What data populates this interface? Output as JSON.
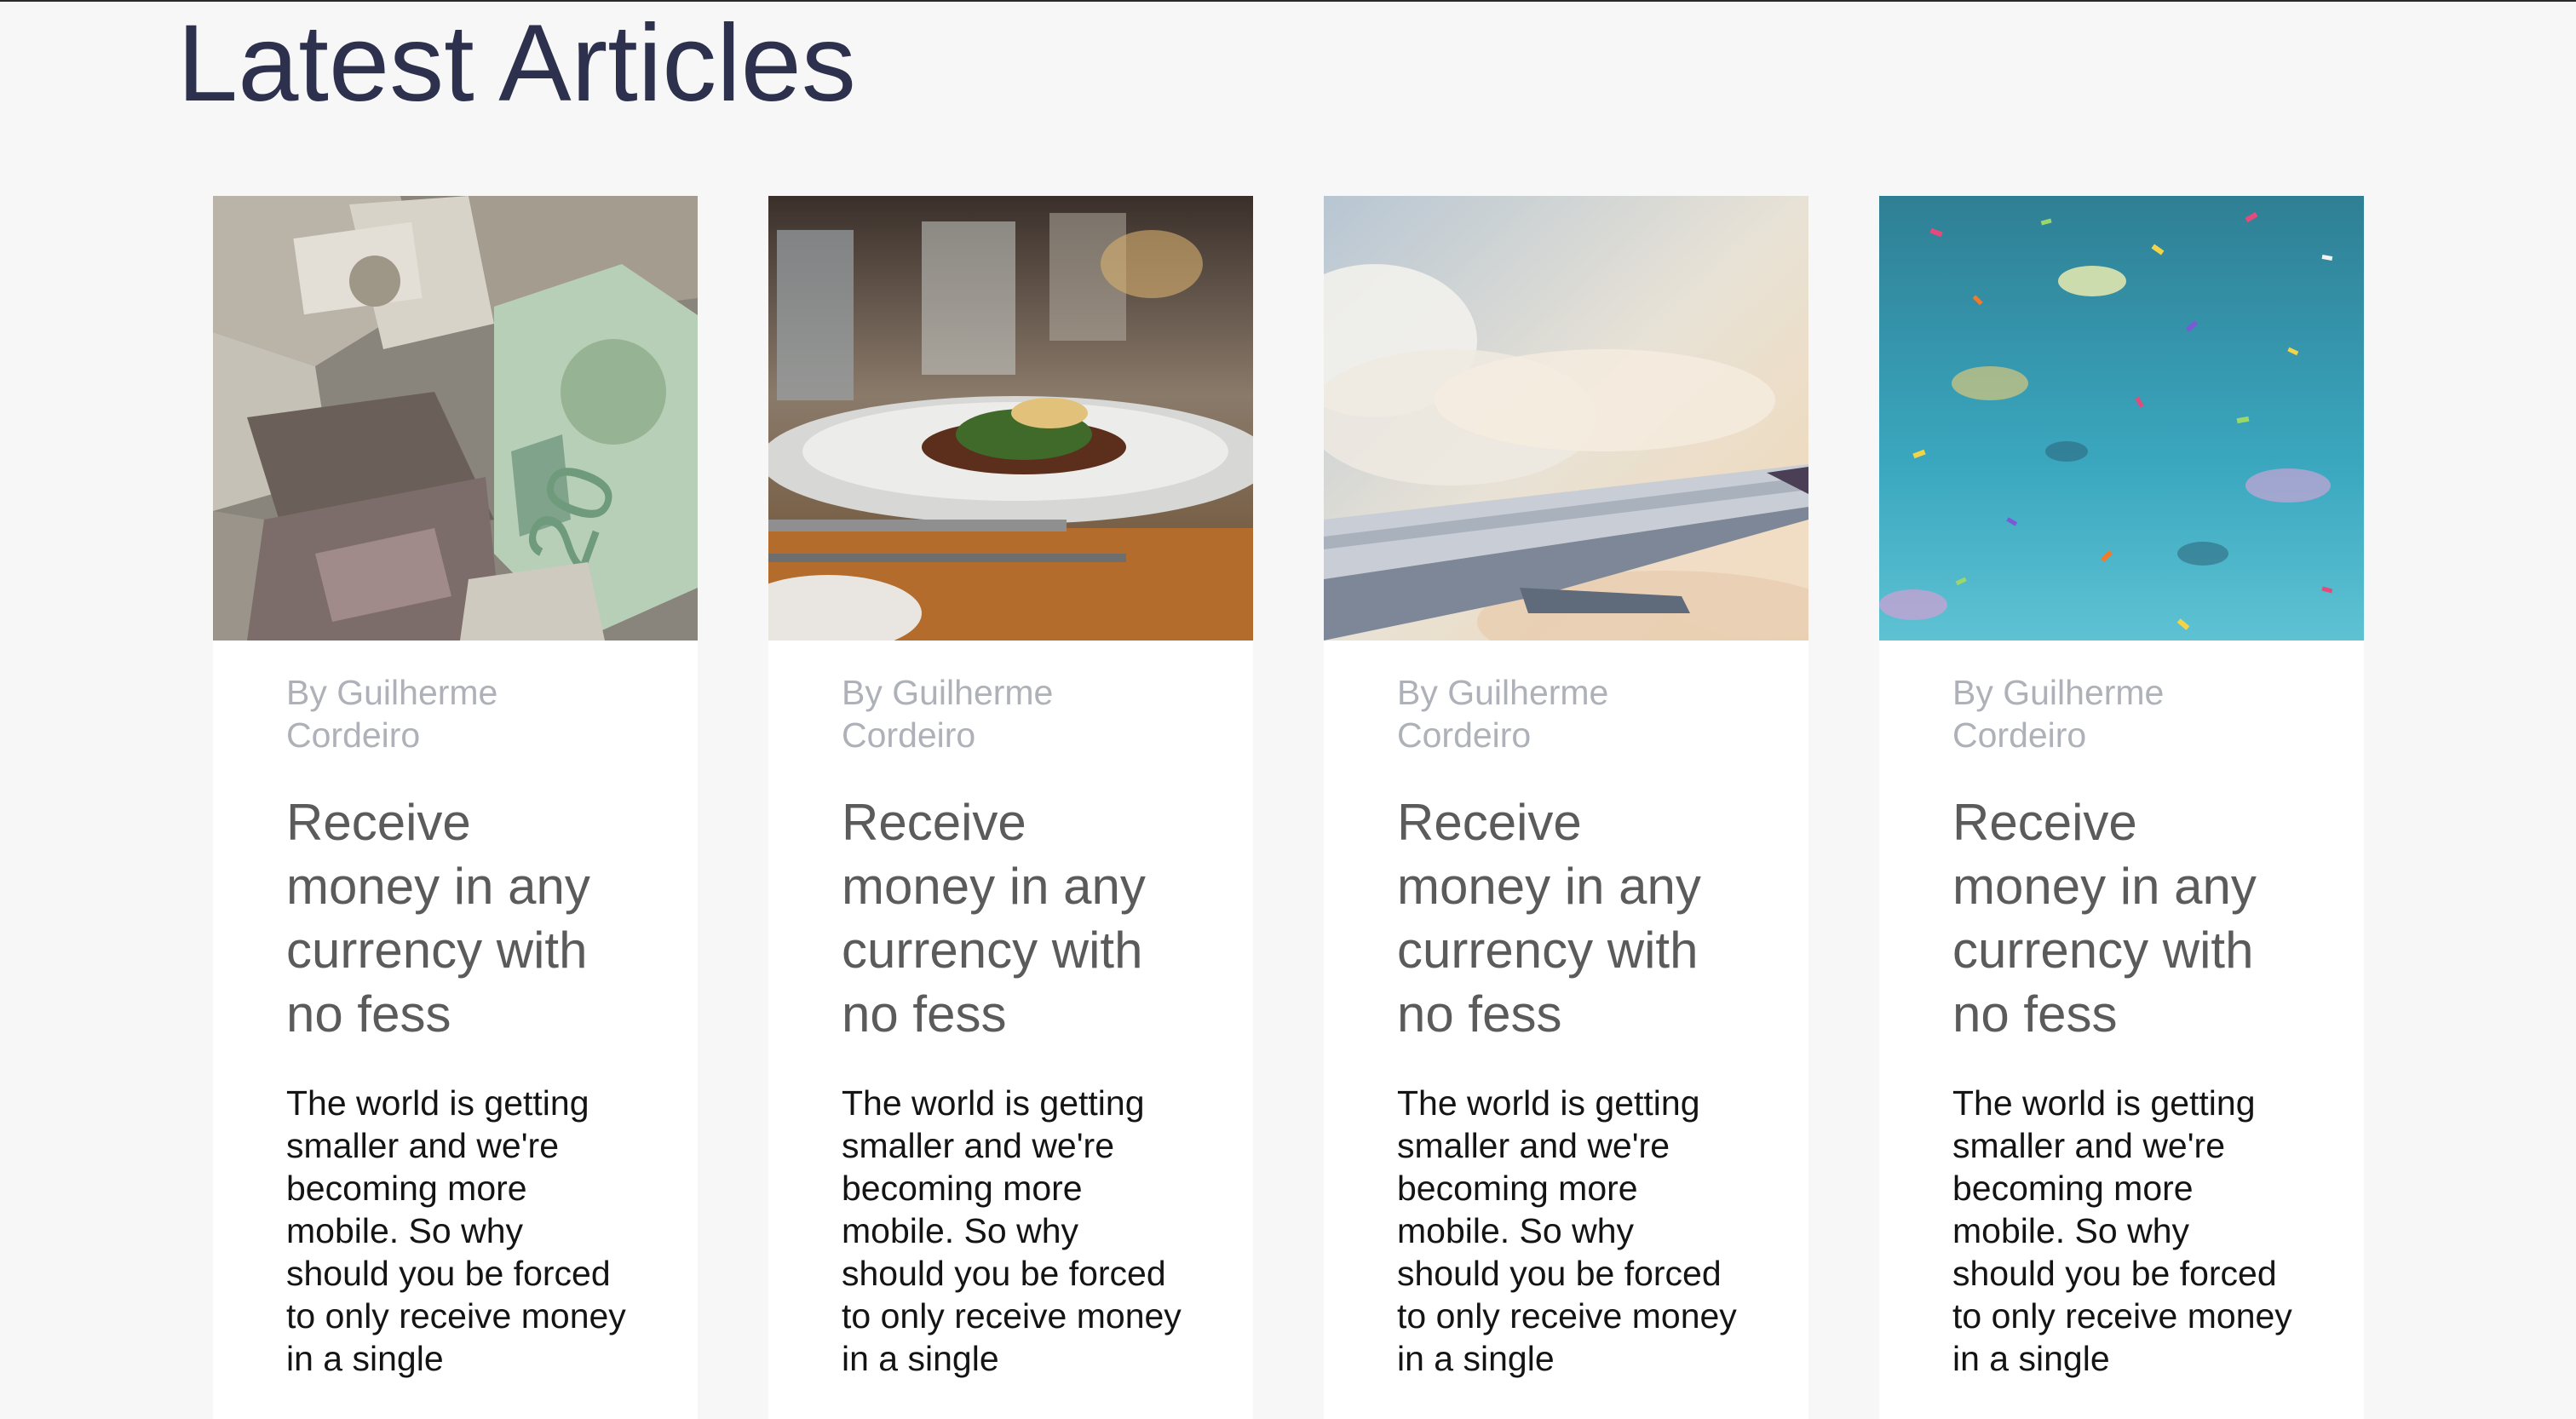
{
  "page": {
    "title": "Latest Articles"
  },
  "colors": {
    "page_background": "#f7f7f7",
    "title": "#2d314d",
    "author": "#aeb1b8",
    "card_title": "#5b5b5b",
    "excerpt": "#141414"
  },
  "articles": [
    {
      "image_icon": "currency-banknotes-photo",
      "author": "By Guilherme Cordeiro",
      "title": "Receive money in any currency with no fess",
      "excerpt": "The world is getting smaller and we're becoming more mobile. So why should you be forced to only receive money in a single"
    },
    {
      "image_icon": "restaurant-dish-photo",
      "author": "By Guilherme Cordeiro",
      "title": "Receive money in any currency with no fess",
      "excerpt": "The world is getting smaller and we're becoming more mobile. So why should you be forced to only receive money in a single"
    },
    {
      "image_icon": "airplane-wing-clouds-photo",
      "author": "By Guilherme Cordeiro",
      "title": "Receive money in any currency with no fess",
      "excerpt": "The world is getting smaller and we're becoming more mobile. So why should you be forced to only receive money in a single"
    },
    {
      "image_icon": "confetti-photo",
      "author": "By Guilherme Cordeiro",
      "title": "Receive money in any currency with no fess",
      "excerpt": "The world is getting smaller and we're becoming more mobile. So why should you be forced to only receive money in a single"
    }
  ]
}
